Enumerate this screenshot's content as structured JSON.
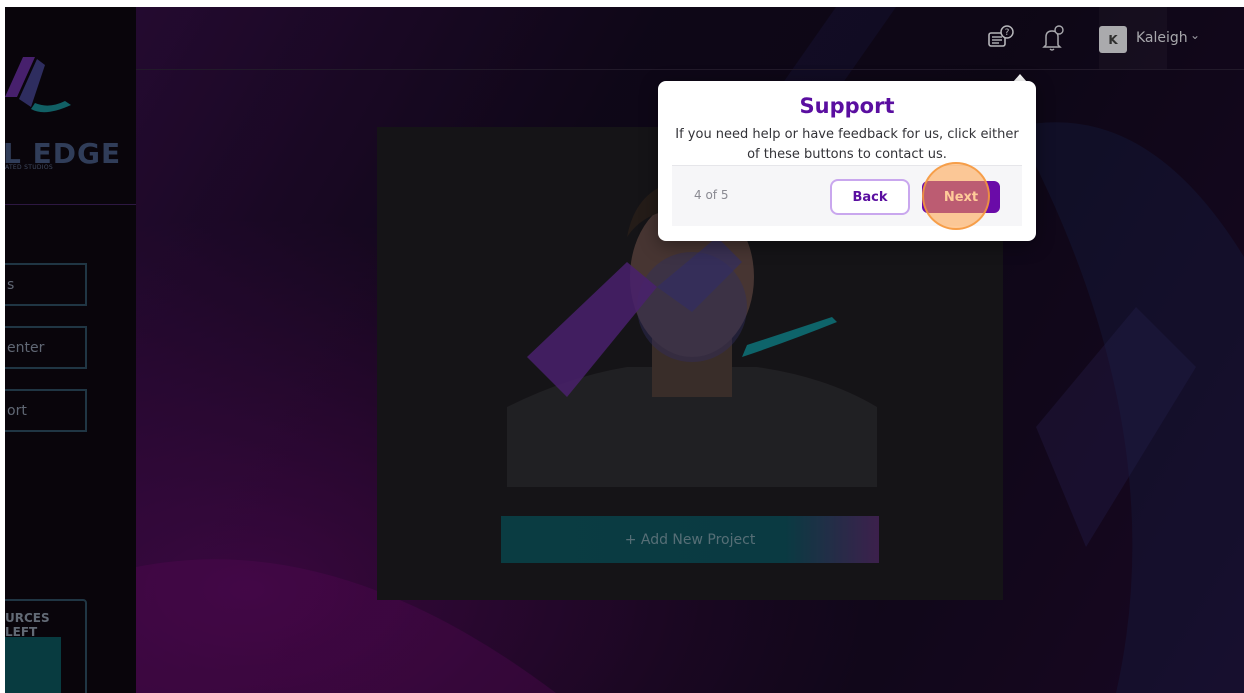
{
  "app": {
    "logo_text": "L EDGE",
    "logo_subtext": "ATED STUDIOS"
  },
  "sidebar": {
    "items": [
      {
        "label": "s"
      },
      {
        "label": "enter"
      },
      {
        "label": "ort"
      }
    ],
    "resources_label": "URCES LEFT"
  },
  "header": {
    "avatar_initial": "K",
    "username": "Kaleigh",
    "support_icon": "support-chat-icon",
    "notification_icon": "bell-icon"
  },
  "main": {
    "add_project_label": "+ Add New Project"
  },
  "tour": {
    "title": "Support",
    "body": "If you need help or have feedback for us, click either of these buttons to contact us.",
    "step": "4 of 5",
    "back_label": "Back",
    "next_label": "Next"
  },
  "colors": {
    "accent": "#6a0ba8",
    "title": "#5a0ea0",
    "highlight": "#f59a3c",
    "teal": "#0e4d55"
  }
}
